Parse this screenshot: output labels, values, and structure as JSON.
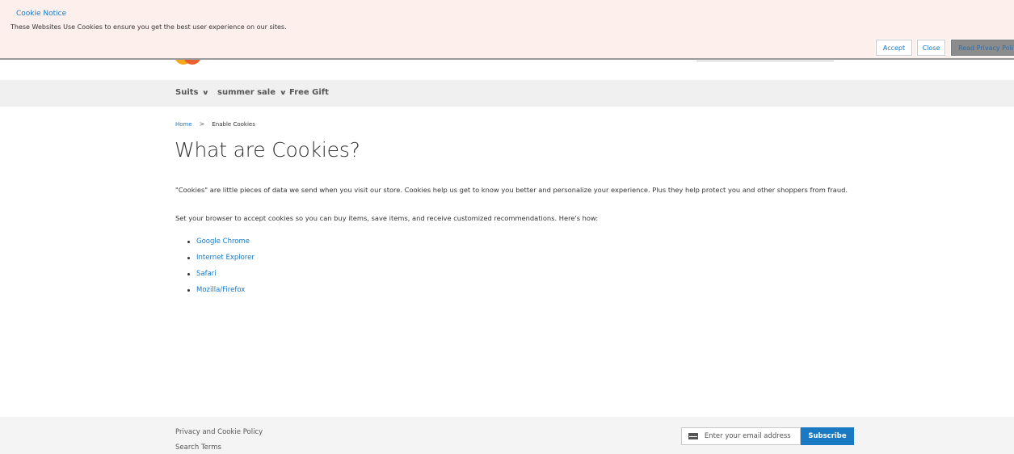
{
  "cookie_notice": {
    "title": "Cookie Notice",
    "text": "These Websites Use Cookies to ensure you get the best user experience on our sites.",
    "accept_label": "Accept",
    "close_label": "Close",
    "privacy_label": "Read Privacy Poli"
  },
  "nav": {
    "items": [
      {
        "label": "Suits"
      },
      {
        "label": "summer sale"
      },
      {
        "label": "Free Gift"
      }
    ]
  },
  "breadcrumb": {
    "home": "Home",
    "separator": ">",
    "current": "Enable Cookies"
  },
  "page": {
    "title": "What are Cookies?",
    "paragraph1": "\"Cookies\" are little pieces of data we send when you visit our store. Cookies help us get to know you better and personalize your experience. Plus they help protect you and other shoppers from fraud.",
    "paragraph2": "Set your browser to accept cookies so you can buy items, save items, and receive customized recommendations. Here's how:",
    "browsers": [
      "Google Chrome",
      "Internet Explorer",
      "Safari",
      "Mozilla/Firefox"
    ]
  },
  "footer": {
    "links": [
      "Privacy and Cookie Policy",
      "Search Terms"
    ],
    "email_placeholder": "Enter your email address",
    "subscribe_label": "Subscribe"
  },
  "colors": {
    "link": "#1979c3",
    "cookie_bg": "#fdf0ec",
    "nav_bg": "#f0f0f0",
    "footer_bg": "#f4f4f4",
    "subscribe_bg": "#1979c3"
  }
}
